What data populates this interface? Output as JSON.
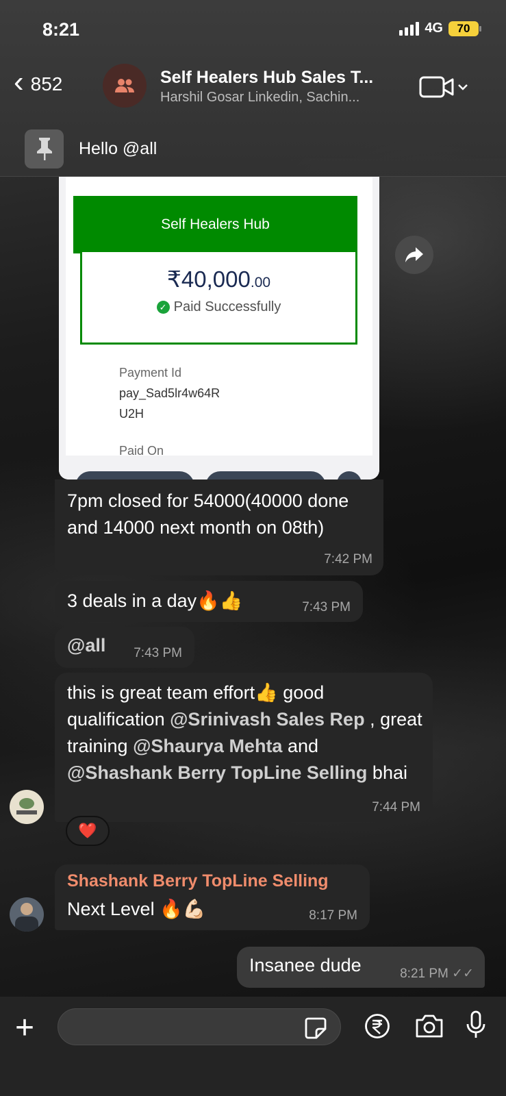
{
  "status": {
    "time": "8:21",
    "network": "4G",
    "battery": "70"
  },
  "header": {
    "back_count": "852",
    "group_title": "Self Healers Hub Sales T...",
    "group_subtitle": "Harshil Gosar Linkedin, Sachin...",
    "avatar_icon": "group-icon",
    "video_icon": "video-call-icon"
  },
  "pinned": {
    "text": "Hello @all",
    "icon": "pin-icon"
  },
  "receipt": {
    "merchant": "Self Healers Hub",
    "amount_main": "₹40,000",
    "amount_decimal": ".00",
    "status": "Paid Successfully",
    "payment_id_label": "Payment Id",
    "payment_id_line1": "pay_Sad5lr4w64R",
    "payment_id_line2": "U2H",
    "paid_on_label": "Paid On"
  },
  "messages": [
    {
      "text": "7pm closed for 54000(40000 done and 14000 next month on 08th)",
      "time": "7:42 PM"
    },
    {
      "text": "3 deals in  a day🔥👍",
      "time": "7:43 PM"
    },
    {
      "text": "@all",
      "time": "7:43 PM"
    },
    {
      "parts": [
        "this is great team effort👍 good qualification ",
        "@Srinivash Sales Rep",
        " , great training ",
        "@Shaurya Mehta",
        " and ",
        "@Shashank Berry TopLine Selling",
        " bhai"
      ],
      "time": "7:44 PM",
      "reaction": "❤️"
    },
    {
      "sender": "Shashank Berry TopLine Selling",
      "text": "Next Level 🔥💪🏻",
      "time": "8:17 PM"
    },
    {
      "text": "Insanee dude",
      "time": "8:21 PM",
      "outgoing": true
    }
  ],
  "composer": {
    "placeholder": "",
    "icons": [
      "plus-icon",
      "sticker-icon",
      "rupee-icon",
      "camera-icon",
      "microphone-icon"
    ]
  },
  "colors": {
    "accent_green": "#008a00",
    "sender_name": "#f08c6c",
    "battery": "#f5d03b"
  }
}
